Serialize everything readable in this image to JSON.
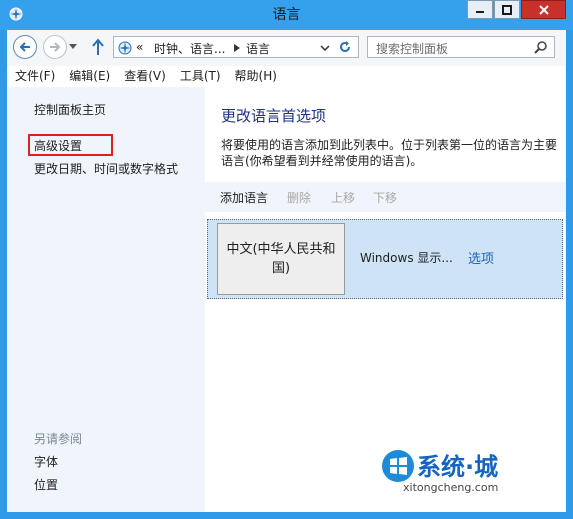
{
  "window": {
    "title": "语言"
  },
  "nav": {
    "breadcrumb": [
      "«",
      "时钟、语言...",
      "语言"
    ],
    "search_placeholder": "搜索控制面板"
  },
  "menu": [
    "文件(F)",
    "编辑(E)",
    "查看(V)",
    "工具(T)",
    "帮助(H)"
  ],
  "sidebar": {
    "home": "控制面板主页",
    "advanced": "高级设置",
    "date_time": "更改日期、时间或数字格式",
    "see_also": "另请参阅",
    "fonts": "字体",
    "location": "位置"
  },
  "main": {
    "heading": "更改语言首选项",
    "description": "将要使用的语言添加到此列表中。位于列表第一位的语言为主要语言(你希望看到并经常使用的语言)。",
    "toolbar": {
      "add": "添加语言",
      "remove": "删除",
      "up": "上移",
      "down": "下移"
    },
    "language": {
      "name": "中文(中华人民共和国)",
      "display": "Windows 显示...",
      "options": "选项"
    }
  },
  "watermark": {
    "text": "系统·城",
    "url": "xitongcheng.com"
  },
  "colors": {
    "title_bar": "#35a0ec",
    "sidebar_bg": "#f0f5fb",
    "selected_row": "#cfe3f7",
    "link": "#1e3287",
    "close_button": "#c7302b",
    "highlight_box": "#e02020"
  }
}
